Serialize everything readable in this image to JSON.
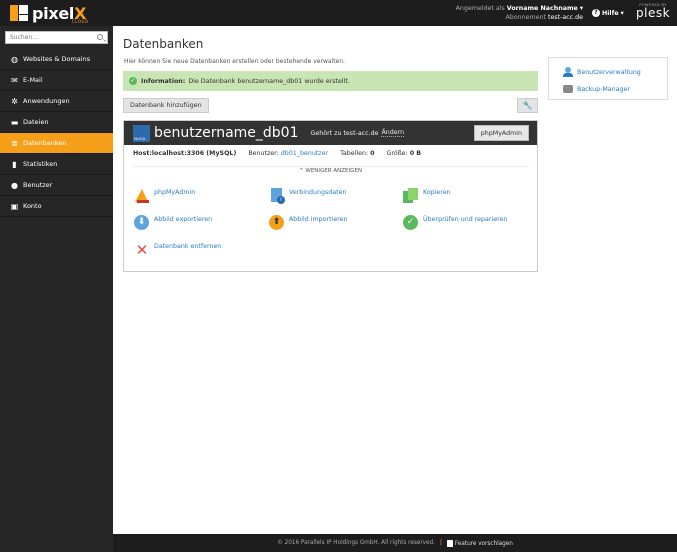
{
  "brand": {
    "name": "pixel",
    "accent_letter": "X",
    "sub": "CLOUD"
  },
  "header": {
    "logged_in_label": "Angemeldet als",
    "user_name": "Vorname Nachname",
    "subscription_label": "Abonnement",
    "subscription_value": "test-acc.de",
    "help_label": "Hilfe",
    "plesk_small": "POWERED BY",
    "plesk_name": "plesk"
  },
  "sidebar": {
    "search_placeholder": "Suchen...",
    "items": [
      {
        "label": "Websites & Domains",
        "icon": "globe-icon"
      },
      {
        "label": "E-Mail",
        "icon": "mail-icon"
      },
      {
        "label": "Anwendungen",
        "icon": "gear-icon"
      },
      {
        "label": "Dateien",
        "icon": "folder-icon"
      },
      {
        "label": "Datenbanken",
        "icon": "database-icon",
        "active": true
      },
      {
        "label": "Statistiken",
        "icon": "bar-chart-icon"
      },
      {
        "label": "Benutzer",
        "icon": "user-icon"
      },
      {
        "label": "Konto",
        "icon": "account-icon"
      }
    ]
  },
  "main": {
    "title": "Datenbanken",
    "description": "Hier können Sie neue Datenbanken erstellen oder bestehende verwalten.",
    "alert_strong": "Information:",
    "alert_text": "Die Datenbank benutzername_db01 wurde erstellt.",
    "add_button": "Datenbank hinzufügen",
    "db": {
      "name": "benutzername_db01",
      "owner_prefix": "Gehört zu test-acc.de",
      "owner_link": "Ändern",
      "pma_button": "phpMyAdmin",
      "host_label": "Host:localhost:3306 (MySQL)",
      "user_label": "Benutzer:",
      "user_value": "db01_benutzer",
      "tables_label": "Tabellen:",
      "tables_value": "0",
      "size_label": "Größe:",
      "size_value": "0 B",
      "less_label": "WENIGER ANZEIGEN",
      "actions": {
        "phpmyadmin": "phpMyAdmin",
        "connection": "Verbindungsdaten",
        "copy": "Kopieren",
        "export": "Abbild exportieren",
        "import": "Abbild importieren",
        "check": "Überprüfen und reparieren",
        "remove": "Datenbank entfernen"
      }
    }
  },
  "side_panel": {
    "user_management": "Benutzerverwaltung",
    "backup_manager": "Backup-Manager"
  },
  "footer": {
    "copyright": "© 2016 Parallels IP Holdings GmbH. All rights reserved.",
    "feature": "Feature vorschlagen"
  },
  "colors": {
    "accent": "#f6a01a",
    "link": "#2a7dc0",
    "success_bg": "#c9e5b3",
    "dark": "#1d1d1d"
  }
}
